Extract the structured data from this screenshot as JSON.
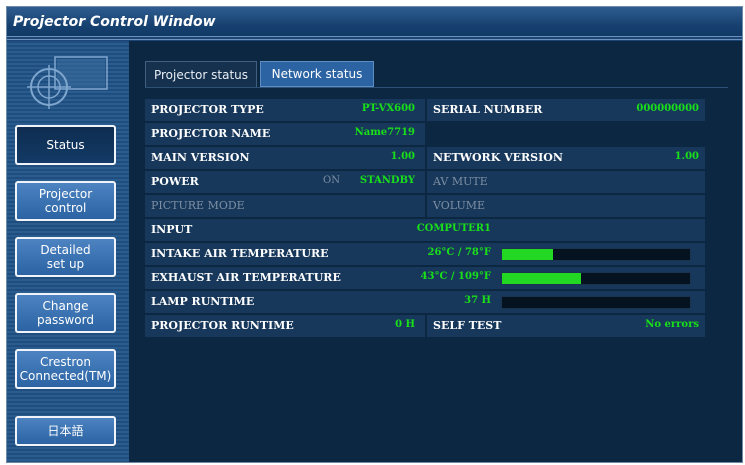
{
  "window": {
    "title": "Projector Control Window"
  },
  "sidebar": {
    "items": [
      {
        "label": "Status",
        "active": true
      },
      {
        "label": "Projector\ncontrol",
        "active": false
      },
      {
        "label": "Detailed\nset up",
        "active": false
      },
      {
        "label": "Change\npassword",
        "active": false
      },
      {
        "label": "Crestron\nConnected(TM)",
        "active": false
      },
      {
        "label": "日本語",
        "active": false
      }
    ]
  },
  "tabs": [
    {
      "label": "Projector status",
      "active": true
    },
    {
      "label": "Network status",
      "active": false
    }
  ],
  "status": {
    "projector_type": {
      "label": "PROJECTOR TYPE",
      "value": "PT-VX600"
    },
    "serial_number": {
      "label": "SERIAL NUMBER",
      "value": "000000000"
    },
    "projector_name": {
      "label": "PROJECTOR NAME",
      "value": "Name7719"
    },
    "main_version": {
      "label": "MAIN VERSION",
      "value": "1.00"
    },
    "network_version": {
      "label": "NETWORK VERSION",
      "value": "1.00"
    },
    "power": {
      "label": "POWER",
      "on": "ON",
      "standby": "STANDBY"
    },
    "av_mute": {
      "label": "AV MUTE"
    },
    "picture_mode": {
      "label": "PICTURE MODE"
    },
    "volume": {
      "label": "VOLUME"
    },
    "input": {
      "label": "INPUT",
      "value": "COMPUTER1"
    },
    "intake_air": {
      "label": "INTAKE AIR TEMPERATURE",
      "value": "26°C / 78°F",
      "level": 0.27
    },
    "exhaust_air": {
      "label": "EXHAUST AIR TEMPERATURE",
      "value": "43°C / 109°F",
      "level": 0.42
    },
    "lamp_runtime": {
      "label": "LAMP RUNTIME",
      "value": "37 H",
      "level": 0.0
    },
    "projector_runtime": {
      "label": "PROJECTOR RUNTIME",
      "value": "0 H"
    },
    "self_test": {
      "label": "SELF TEST",
      "value": "No errors"
    }
  },
  "colors": {
    "accent_green": "#22d822",
    "background": "#0b2742",
    "row_bg": "#17385b",
    "button_blue": "#2b63a3"
  }
}
